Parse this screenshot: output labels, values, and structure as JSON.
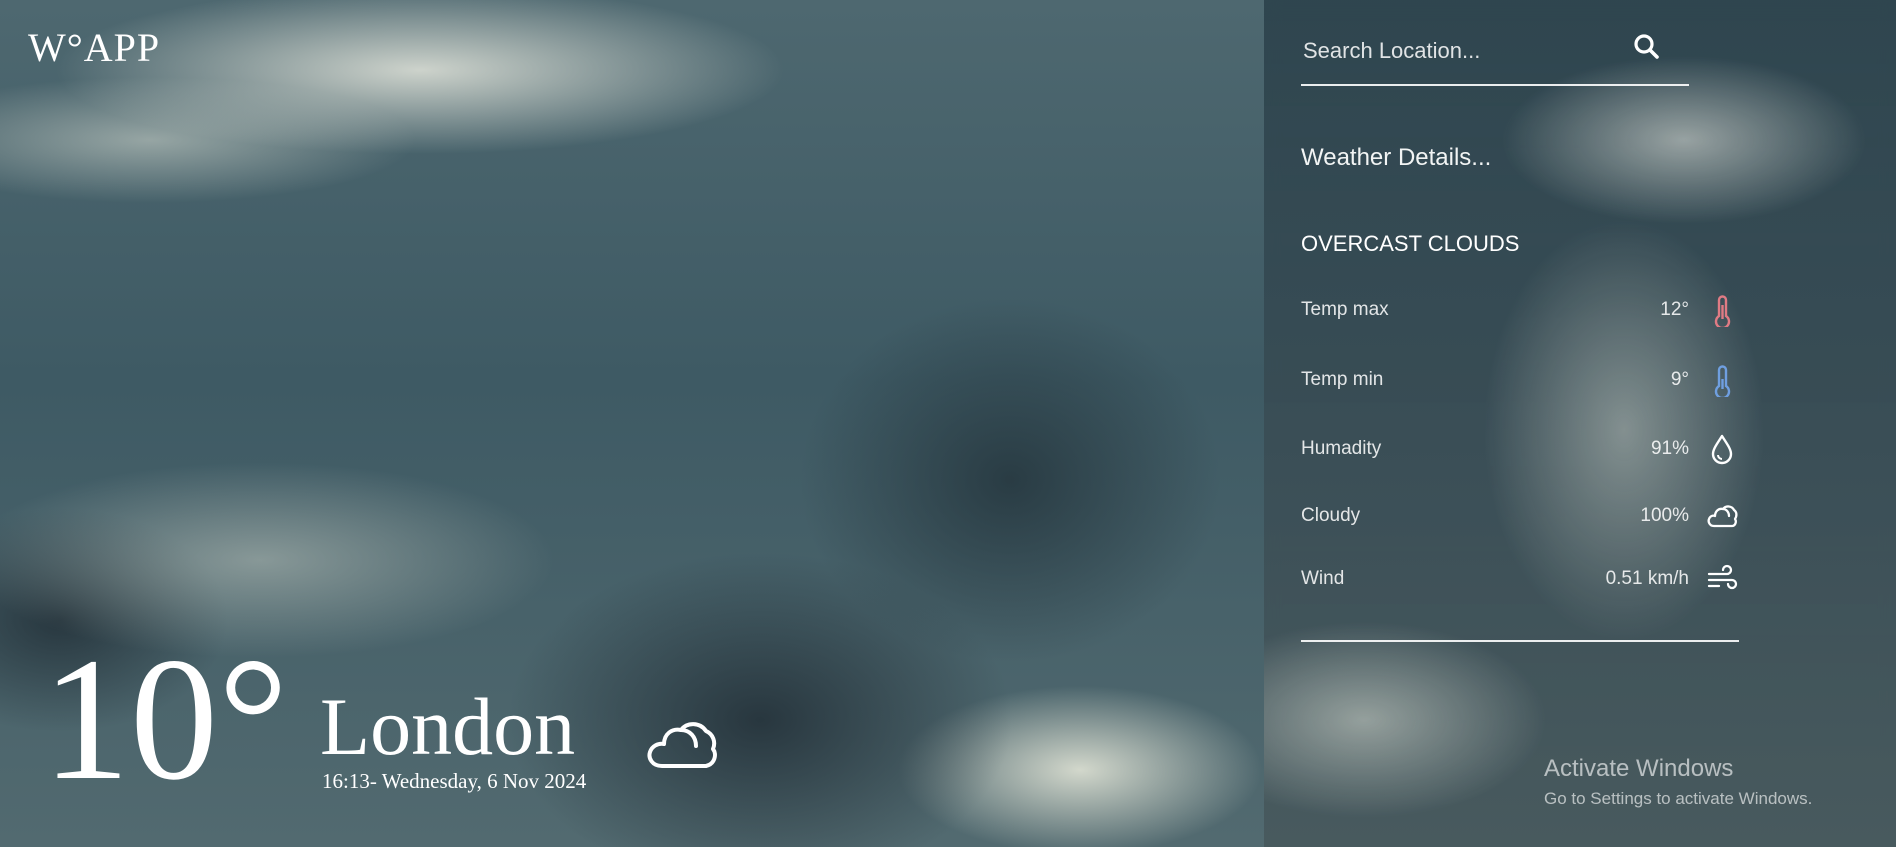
{
  "app": {
    "logo": "W°APP"
  },
  "current": {
    "temperature": "10°",
    "city": "London",
    "datetime": "16:13- Wednesday, 6 Nov 2024",
    "icon": "cloud-icon"
  },
  "search": {
    "placeholder": "Search Location...",
    "icon": "search-icon"
  },
  "details": {
    "title": "Weather Details...",
    "condition": "OVERCAST CLOUDS",
    "rows": [
      {
        "label": "Temp max",
        "value": "12°",
        "icon": "thermometer-hot-icon",
        "color": "#e07b84"
      },
      {
        "label": "Temp min",
        "value": "9°",
        "icon": "thermometer-cold-icon",
        "color": "#6f9fe0"
      },
      {
        "label": "Humadity",
        "value": "91%",
        "icon": "droplet-icon",
        "color": "#ffffff"
      },
      {
        "label": "Cloudy",
        "value": "100%",
        "icon": "cloud-icon",
        "color": "#ffffff"
      },
      {
        "label": "Wind",
        "value": "0.51 km/h",
        "icon": "wind-icon",
        "color": "#ffffff"
      }
    ]
  },
  "watermark": {
    "title": "Activate Windows",
    "subtitle": "Go to Settings to activate Windows."
  }
}
